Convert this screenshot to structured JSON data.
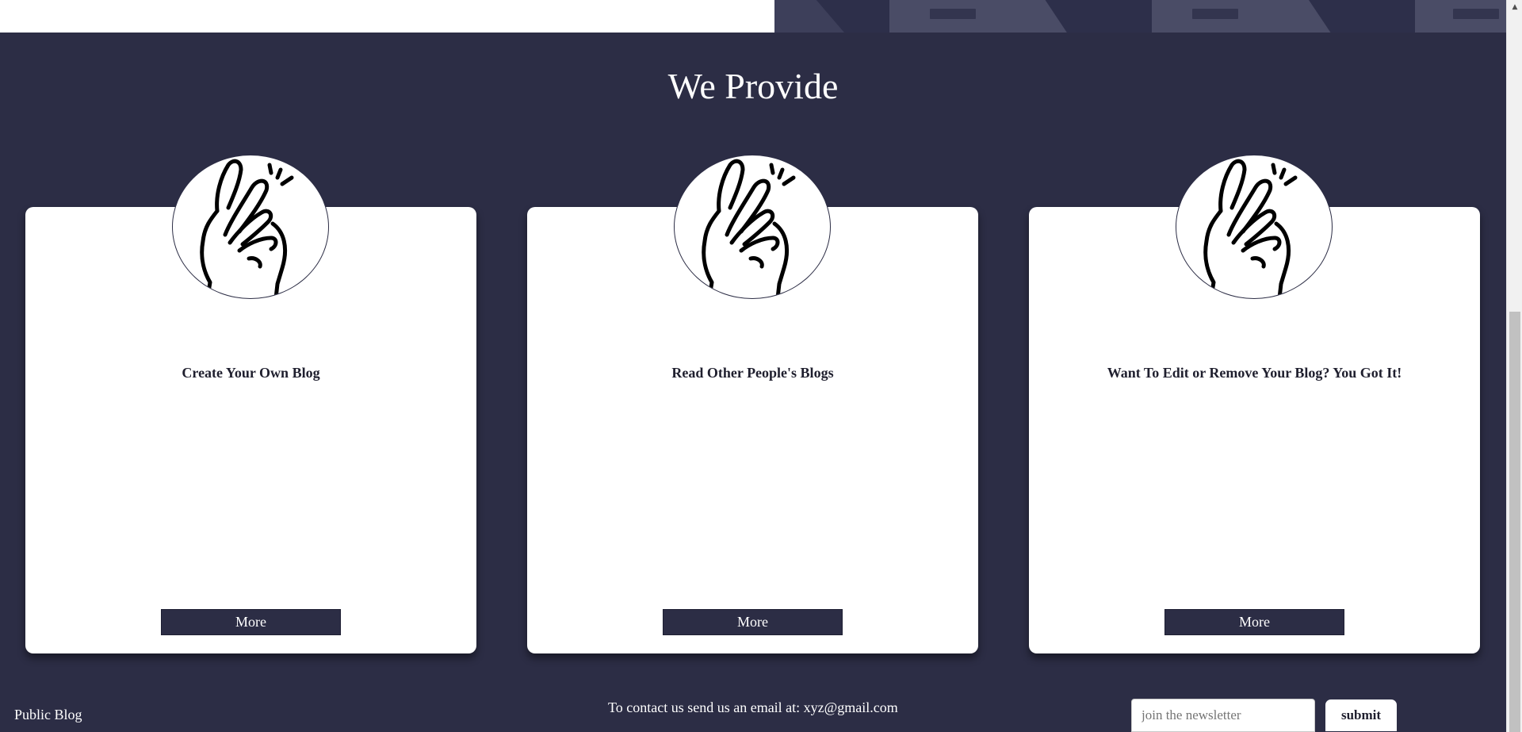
{
  "section": {
    "title": "We Provide"
  },
  "cards": [
    {
      "title": "Create Your Own Blog",
      "button": "More",
      "icon": "finger-snap-icon"
    },
    {
      "title": "Read Other People's Blogs",
      "button": "More",
      "icon": "finger-snap-icon"
    },
    {
      "title": "Want To Edit or Remove Your Blog? You Got It!",
      "button": "More",
      "icon": "finger-snap-icon"
    }
  ],
  "footer": {
    "brand": "Public Blog",
    "contact": "To contact us send us an email at: xyz@gmail.com",
    "newsletter_placeholder": "join the newsletter",
    "submit_label": "submit"
  },
  "colors": {
    "background": "#2c2d45",
    "card": "#ffffff",
    "button": "#2c2d45"
  }
}
